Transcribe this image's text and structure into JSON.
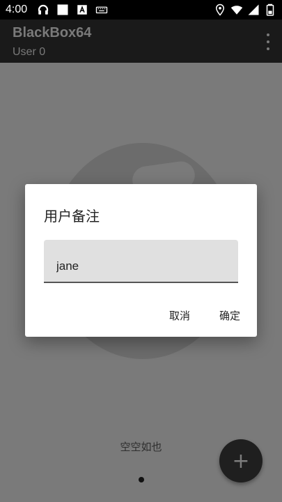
{
  "status_bar": {
    "time": "4:00",
    "left_icons": [
      "headphones-icon",
      "square-icon",
      "font-icon",
      "keyboard-icon"
    ],
    "right_icons": [
      "location-icon",
      "wifi-icon",
      "signal-icon",
      "battery-icon"
    ]
  },
  "app_bar": {
    "title": "BlackBox64",
    "subtitle": "User 0",
    "menu_icon": "overflow-menu-icon"
  },
  "content": {
    "empty_text": "空空如也",
    "fab_label": "+"
  },
  "dialog": {
    "title": "用户备注",
    "input_value": "jane",
    "cancel_label": "取消",
    "confirm_label": "确定"
  },
  "colors": {
    "status_bar": "#000000",
    "app_bar": "#1a1a1a",
    "scrim_background": "#7a7a7a",
    "dialog_background": "#ffffff",
    "input_background": "#e0e0e0"
  }
}
